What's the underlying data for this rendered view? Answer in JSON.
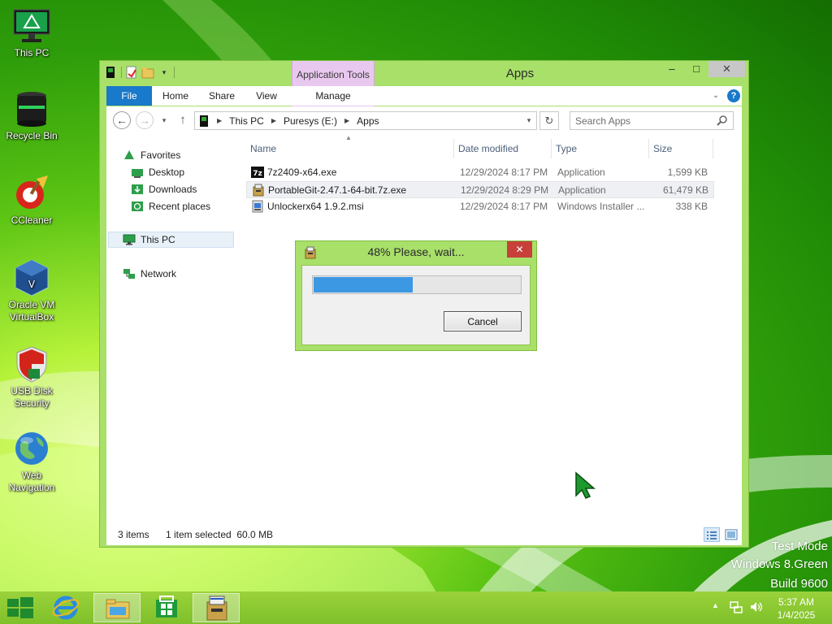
{
  "desktop": {
    "icons": [
      {
        "label": "This PC",
        "icon": "monitor-icon"
      },
      {
        "label": "Recycle Bin",
        "icon": "recycle-bin-icon"
      },
      {
        "label": "CCleaner",
        "icon": "ccleaner-icon"
      },
      {
        "label": "Oracle VM VirtualBox",
        "icon": "virtualbox-icon"
      },
      {
        "label": "USB Disk Security",
        "icon": "shield-icon"
      },
      {
        "label": "Web Navigation",
        "icon": "globe-icon"
      }
    ],
    "watermark": [
      "Test Mode",
      "Windows 8.Green",
      "Build 9600"
    ]
  },
  "explorer": {
    "title": "Apps",
    "context_tab_group": "Application Tools",
    "ribbon_tabs": {
      "file": "File",
      "home": "Home",
      "share": "Share",
      "view": "View",
      "manage": "Manage"
    },
    "window_controls": {
      "minimize": "–",
      "maximize": "□",
      "close": "✕"
    },
    "breadcrumb": [
      "This PC",
      "Puresys (E:)",
      "Apps"
    ],
    "search_placeholder": "Search Apps",
    "nav_pane": {
      "favorites": "Favorites",
      "desktop": "Desktop",
      "downloads": "Downloads",
      "recent_places": "Recent places",
      "this_pc": "This PC",
      "network": "Network"
    },
    "columns": {
      "name": "Name",
      "date_modified": "Date modified",
      "type": "Type",
      "size": "Size"
    },
    "files": [
      {
        "name": "7z2409-x64.exe",
        "date": "12/29/2024 8:17 PM",
        "type": "Application",
        "size": "1,599 KB",
        "icon": "7zip-icon"
      },
      {
        "name": "PortableGit-2.47.1-64-bit.7z.exe",
        "date": "12/29/2024 8:29 PM",
        "type": "Application",
        "size": "61,479 KB",
        "icon": "installer-icon"
      },
      {
        "name": "Unlockerx64 1.9.2.msi",
        "date": "12/29/2024 8:17 PM",
        "type": "Windows Installer ...",
        "size": "338 KB",
        "icon": "msi-icon"
      }
    ],
    "status": {
      "items": "3 items",
      "selected": "1 item selected  60.0 MB"
    }
  },
  "progress_dialog": {
    "title": "48% Please, wait...",
    "progress": 0.48,
    "cancel_label": "Cancel",
    "close": "✕"
  },
  "taskbar": {
    "clock_time": "5:37 AM",
    "clock_date": "1/4/2025"
  },
  "colors": {
    "accent_blue": "#1979ca",
    "progress_blue": "#3c98e3",
    "window_frame_green": "#a8e06a",
    "taskbar_green": "#8cc832",
    "close_red": "#c7413a",
    "context_tab_purple": "#e9c8ef"
  }
}
